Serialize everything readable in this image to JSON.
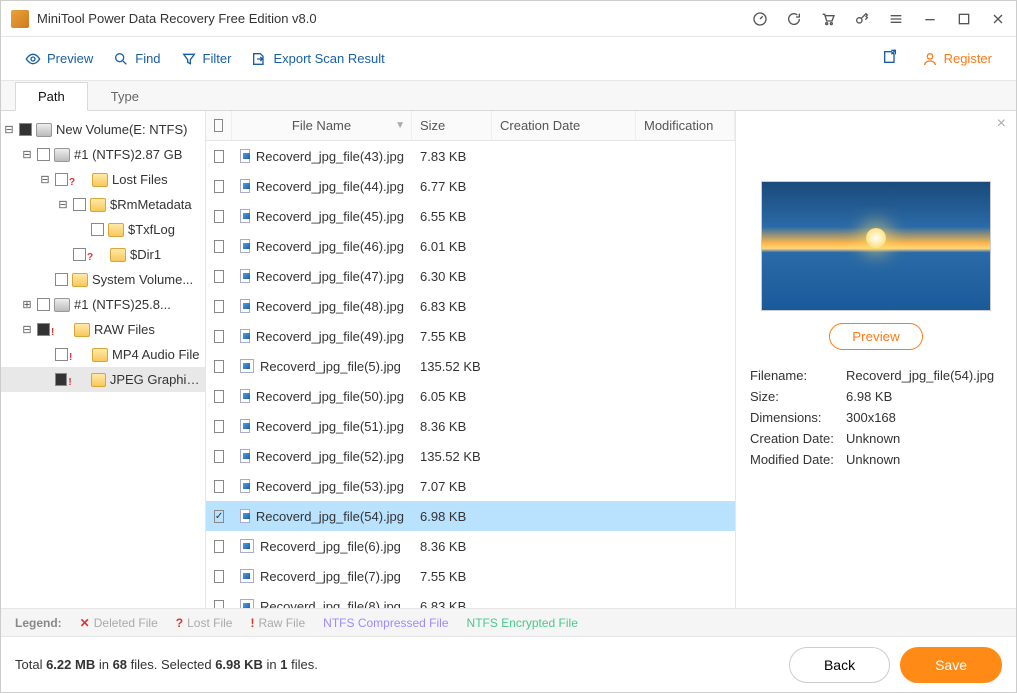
{
  "app": {
    "title": "MiniTool Power Data Recovery Free Edition v8.0"
  },
  "toolbar": {
    "preview": "Preview",
    "find": "Find",
    "filter": "Filter",
    "export": "Export Scan Result",
    "register": "Register"
  },
  "tabs": {
    "path": "Path",
    "type": "Type"
  },
  "tree": {
    "root": "New Volume(E: NTFS)",
    "n1": "#1 (NTFS)2.87 GB",
    "lost": "Lost Files",
    "rm": "$RmMetadata",
    "txf": "$TxfLog",
    "dir1": "$Dir1",
    "sysvol": "System Volume...",
    "n2": "#1 (NTFS)25.8...",
    "raw": "RAW Files",
    "mp4": "MP4 Audio File",
    "jpeg": "JPEG Graphics..."
  },
  "columns": {
    "name": "File Name",
    "size": "Size",
    "cdate": "Creation Date",
    "mdate": "Modification"
  },
  "files": [
    {
      "name": "Recoverd_jpg_file(43).jpg",
      "size": "7.83 KB"
    },
    {
      "name": "Recoverd_jpg_file(44).jpg",
      "size": "6.77 KB"
    },
    {
      "name": "Recoverd_jpg_file(45).jpg",
      "size": "6.55 KB"
    },
    {
      "name": "Recoverd_jpg_file(46).jpg",
      "size": "6.01 KB"
    },
    {
      "name": "Recoverd_jpg_file(47).jpg",
      "size": "6.30 KB"
    },
    {
      "name": "Recoverd_jpg_file(48).jpg",
      "size": "6.83 KB"
    },
    {
      "name": "Recoverd_jpg_file(49).jpg",
      "size": "7.55 KB"
    },
    {
      "name": "Recoverd_jpg_file(5).jpg",
      "size": "135.52 KB"
    },
    {
      "name": "Recoverd_jpg_file(50).jpg",
      "size": "6.05 KB"
    },
    {
      "name": "Recoverd_jpg_file(51).jpg",
      "size": "8.36 KB"
    },
    {
      "name": "Recoverd_jpg_file(52).jpg",
      "size": "135.52 KB"
    },
    {
      "name": "Recoverd_jpg_file(53).jpg",
      "size": "7.07 KB"
    },
    {
      "name": "Recoverd_jpg_file(54).jpg",
      "size": "6.98 KB",
      "selected": true,
      "checked": true
    },
    {
      "name": "Recoverd_jpg_file(6).jpg",
      "size": "8.36 KB"
    },
    {
      "name": "Recoverd_jpg_file(7).jpg",
      "size": "7.55 KB"
    },
    {
      "name": "Recoverd_jpg_file(8).jpg",
      "size": "6.83 KB"
    }
  ],
  "preview": {
    "button": "Preview",
    "labels": {
      "filename": "Filename:",
      "size": "Size:",
      "dimensions": "Dimensions:",
      "cdate": "Creation Date:",
      "mdate": "Modified Date:"
    },
    "values": {
      "filename": "Recoverd_jpg_file(54).jpg",
      "size": "6.98 KB",
      "dimensions": "300x168",
      "cdate": "Unknown",
      "mdate": "Unknown"
    }
  },
  "legend": {
    "title": "Legend:",
    "deleted": "Deleted File",
    "lost": "Lost File",
    "raw": "Raw File",
    "ntfs_comp": "NTFS Compressed File",
    "ntfs_enc": "NTFS Encrypted File"
  },
  "footer": {
    "status_pre": "Total ",
    "total_size": "6.22 MB",
    "status_mid1": " in ",
    "total_files": "68",
    "status_mid2": " files.  Selected ",
    "sel_size": "6.98 KB",
    "status_mid3": " in ",
    "sel_files": "1",
    "status_post": " files.",
    "back": "Back",
    "save": "Save"
  }
}
